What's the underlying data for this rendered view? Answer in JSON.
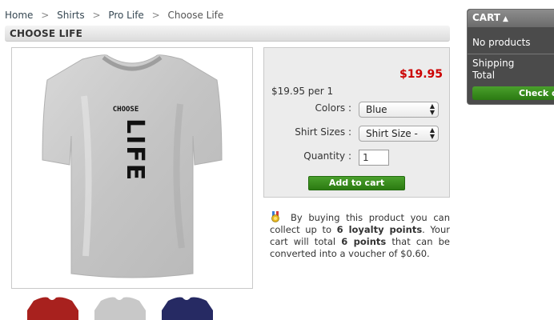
{
  "breadcrumb": {
    "home": "Home",
    "sep1": ">",
    "shirts": "Shirts",
    "sep2": ">",
    "prolife": "Pro Life",
    "sep3": ">",
    "current": "Choose Life"
  },
  "product": {
    "title": "CHOOSE LIFE",
    "shirt_text_top": "CHOOSE",
    "shirt_text_main": "LIFE",
    "price": "$19.95",
    "price_per": "$19.95 per 1",
    "colors_label": "Colors :",
    "colors_value": "Blue",
    "sizes_label": "Shirt Sizes :",
    "sizes_value": "Shirt Size -",
    "quantity_label": "Quantity :",
    "quantity_value": "1",
    "add_to_cart": "Add to cart"
  },
  "loyalty": {
    "p1": "By buying this product you can collect up to ",
    "points1": "6 loyalty points",
    "p2": ". Your cart will total ",
    "points2": "6 points",
    "p3": " that can be converted into a voucher of $0.60."
  },
  "thumbnails": [
    {
      "name": "red",
      "color": "#a8211e"
    },
    {
      "name": "gray",
      "color": "#c8c8c8"
    },
    {
      "name": "navy",
      "color": "#262a63"
    }
  ],
  "cart": {
    "title": "CART",
    "caret": "▲",
    "empty": "No products",
    "shipping": "Shipping",
    "total": "Total",
    "checkout": "Check out"
  },
  "colors": {
    "price": "#cc0000",
    "button_green": "#2b7a12",
    "cart_bg": "#4b4b4b"
  }
}
